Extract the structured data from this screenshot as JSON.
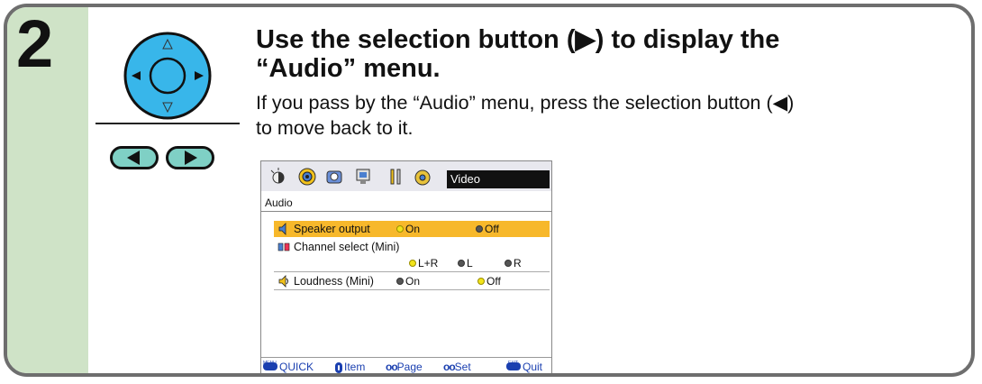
{
  "step": {
    "number": "2"
  },
  "heading": {
    "line1": "Use the selection button (▶) to display the",
    "line2": "“Audio” menu."
  },
  "body": {
    "line1": "If you pass by the “Audio” menu, press the selection button (◀)",
    "line2": "to move back to it."
  },
  "tv_menu": {
    "title": "Video",
    "menu_name": "Audio",
    "rows": [
      {
        "label": "Speaker output",
        "opt1": "On",
        "opt2": "Off"
      },
      {
        "label": "Channel select (Mini)",
        "opt1": "L+R",
        "opt2": "L",
        "opt3": "R"
      },
      {
        "label": "Loudness (Mini)",
        "opt1": "On",
        "opt2": "Off"
      }
    ],
    "footer": {
      "menu_glyph": "MENU",
      "quick": "QUICK",
      "item": "Item",
      "page": "Page",
      "set": "Set",
      "exit_glyph": "EXIT",
      "quit": "Quit"
    }
  },
  "colors": {
    "step_column": "#cfe3c7",
    "dpad_fill": "#38b6ea",
    "highlight_row": "#f7b82b",
    "footer_text": "#1a3fb0"
  }
}
